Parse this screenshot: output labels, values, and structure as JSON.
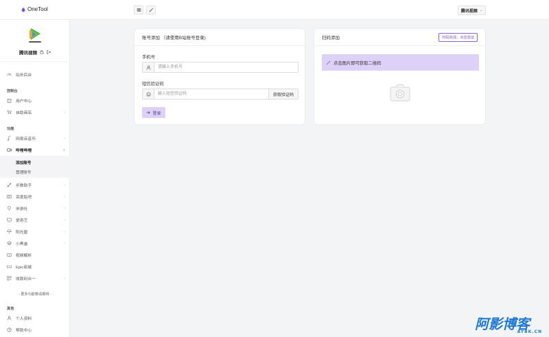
{
  "app": {
    "name": "OneTool"
  },
  "header": {
    "account": "腾讯视频"
  },
  "sidebar": {
    "profile_name": "腾讯视频",
    "station_backend": "站长后台",
    "console_title": "控制台",
    "items_console": [
      {
        "label": "用户中心"
      },
      {
        "label": "自助商店"
      }
    ],
    "func_title": "功能",
    "items_func_top": [
      {
        "label": "网易云音乐"
      },
      {
        "label": "哔哩哔哩"
      }
    ],
    "sub_items": [
      {
        "label": "添加账号"
      },
      {
        "label": "管理账号"
      }
    ],
    "items_func_bottom": [
      {
        "label": "步数助手"
      },
      {
        "label": "百度贴吧"
      },
      {
        "label": "米游社"
      },
      {
        "label": "爱奇艺"
      },
      {
        "label": "阳光屋"
      },
      {
        "label": "小黑盒"
      },
      {
        "label": "视频解析"
      },
      {
        "label": "Epic商城"
      },
      {
        "label": "收款码合一"
      }
    ],
    "more_hint": "- 更多功能敬请期待 -",
    "other_title": "其他",
    "items_other": [
      {
        "label": "个人资料"
      },
      {
        "label": "帮助中心"
      }
    ]
  },
  "account_card": {
    "title": "账号添加 （请使用B站账号登录)",
    "phone_label": "手机号",
    "phone_placeholder": "请输入手机号",
    "phone_value": "",
    "code_label": "短信验证码",
    "code_placeholder": "输入短信验证码",
    "code_value": "",
    "get_code_button": "获取验证码",
    "login_button": "登录"
  },
  "qr_card": {
    "title": "扫码添加",
    "scan_done_button": "扫码完成，点击验证",
    "tip": "点击图片即可获取二维码"
  },
  "watermark": {
    "big": "阿影博客",
    "small": "AYBK.CN"
  },
  "colors": {
    "accent": "#ddd1f8",
    "accent_text": "#7a52c8",
    "watermark": "#1e78d8"
  }
}
